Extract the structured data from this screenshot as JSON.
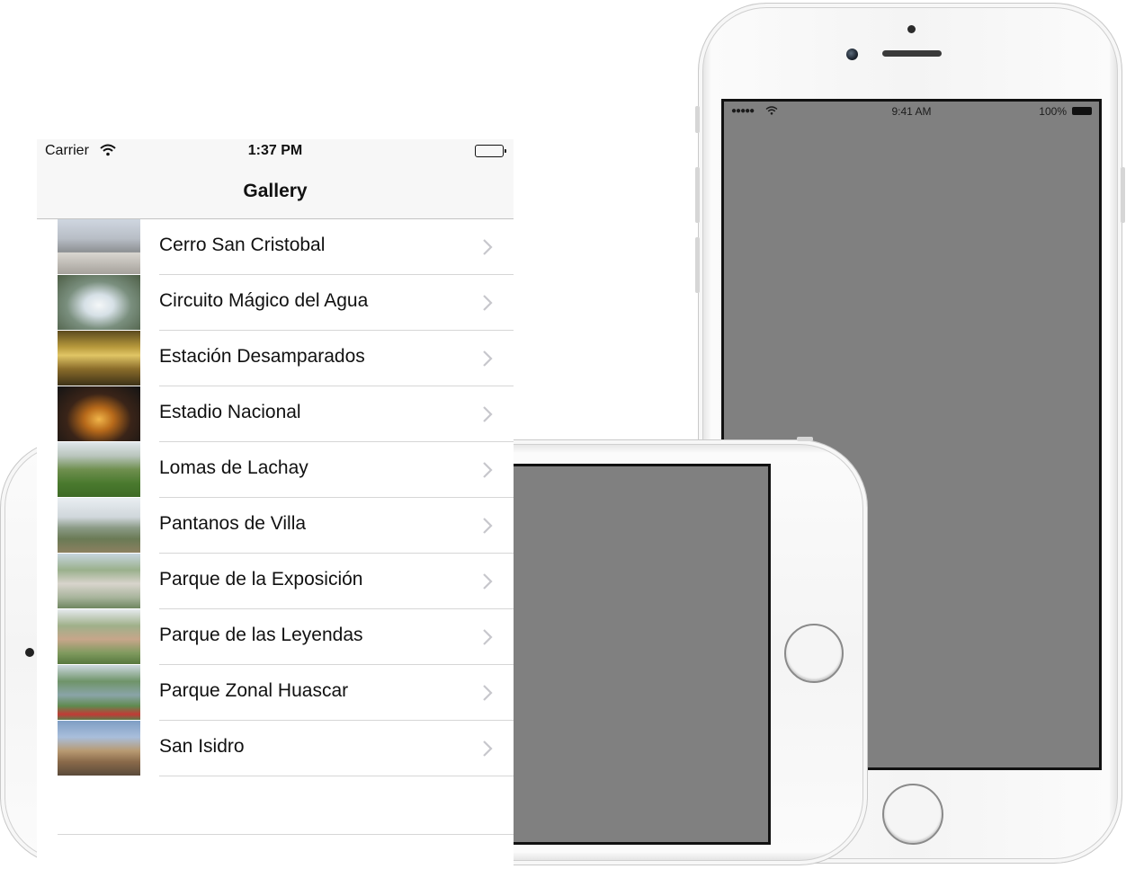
{
  "status_bar": {
    "carrier": "Carrier",
    "time": "1:37 PM"
  },
  "nav": {
    "title": "Gallery"
  },
  "gallery": {
    "items": [
      {
        "label": "Cerro San Cristobal",
        "thumb_icon": "photo-cerro-san-cristobal"
      },
      {
        "label": "Circuito Mágico del Agua",
        "thumb_icon": "photo-circuito-magico"
      },
      {
        "label": "Estación Desamparados",
        "thumb_icon": "photo-estacion-desamparados"
      },
      {
        "label": "Estadio Nacional",
        "thumb_icon": "photo-estadio-nacional"
      },
      {
        "label": "Lomas de Lachay",
        "thumb_icon": "photo-lomas-de-lachay"
      },
      {
        "label": "Pantanos de Villa",
        "thumb_icon": "photo-pantanos-de-villa"
      },
      {
        "label": "Parque de la Exposición",
        "thumb_icon": "photo-parque-exposicion"
      },
      {
        "label": "Parque de las Leyendas",
        "thumb_icon": "photo-parque-leyendas"
      },
      {
        "label": "Parque Zonal Huascar",
        "thumb_icon": "photo-parque-zonal-huascar"
      },
      {
        "label": "San Isidro",
        "thumb_icon": "photo-san-isidro"
      }
    ]
  },
  "device_preview": {
    "time": "9:41 AM",
    "battery": "100%",
    "screen_color": "#808080"
  }
}
